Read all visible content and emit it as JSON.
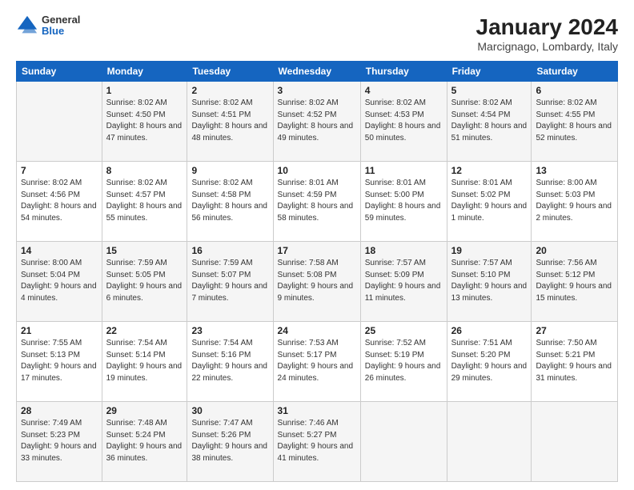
{
  "header": {
    "logo_general": "General",
    "logo_blue": "Blue",
    "main_title": "January 2024",
    "subtitle": "Marcignago, Lombardy, Italy"
  },
  "columns": [
    "Sunday",
    "Monday",
    "Tuesday",
    "Wednesday",
    "Thursday",
    "Friday",
    "Saturday"
  ],
  "weeks": [
    [
      {
        "day": "",
        "sunrise": "",
        "sunset": "",
        "daylight": ""
      },
      {
        "day": "1",
        "sunrise": "Sunrise: 8:02 AM",
        "sunset": "Sunset: 4:50 PM",
        "daylight": "Daylight: 8 hours and 47 minutes."
      },
      {
        "day": "2",
        "sunrise": "Sunrise: 8:02 AM",
        "sunset": "Sunset: 4:51 PM",
        "daylight": "Daylight: 8 hours and 48 minutes."
      },
      {
        "day": "3",
        "sunrise": "Sunrise: 8:02 AM",
        "sunset": "Sunset: 4:52 PM",
        "daylight": "Daylight: 8 hours and 49 minutes."
      },
      {
        "day": "4",
        "sunrise": "Sunrise: 8:02 AM",
        "sunset": "Sunset: 4:53 PM",
        "daylight": "Daylight: 8 hours and 50 minutes."
      },
      {
        "day": "5",
        "sunrise": "Sunrise: 8:02 AM",
        "sunset": "Sunset: 4:54 PM",
        "daylight": "Daylight: 8 hours and 51 minutes."
      },
      {
        "day": "6",
        "sunrise": "Sunrise: 8:02 AM",
        "sunset": "Sunset: 4:55 PM",
        "daylight": "Daylight: 8 hours and 52 minutes."
      }
    ],
    [
      {
        "day": "7",
        "sunrise": "Sunrise: 8:02 AM",
        "sunset": "Sunset: 4:56 PM",
        "daylight": "Daylight: 8 hours and 54 minutes."
      },
      {
        "day": "8",
        "sunrise": "Sunrise: 8:02 AM",
        "sunset": "Sunset: 4:57 PM",
        "daylight": "Daylight: 8 hours and 55 minutes."
      },
      {
        "day": "9",
        "sunrise": "Sunrise: 8:02 AM",
        "sunset": "Sunset: 4:58 PM",
        "daylight": "Daylight: 8 hours and 56 minutes."
      },
      {
        "day": "10",
        "sunrise": "Sunrise: 8:01 AM",
        "sunset": "Sunset: 4:59 PM",
        "daylight": "Daylight: 8 hours and 58 minutes."
      },
      {
        "day": "11",
        "sunrise": "Sunrise: 8:01 AM",
        "sunset": "Sunset: 5:00 PM",
        "daylight": "Daylight: 8 hours and 59 minutes."
      },
      {
        "day": "12",
        "sunrise": "Sunrise: 8:01 AM",
        "sunset": "Sunset: 5:02 PM",
        "daylight": "Daylight: 9 hours and 1 minute."
      },
      {
        "day": "13",
        "sunrise": "Sunrise: 8:00 AM",
        "sunset": "Sunset: 5:03 PM",
        "daylight": "Daylight: 9 hours and 2 minutes."
      }
    ],
    [
      {
        "day": "14",
        "sunrise": "Sunrise: 8:00 AM",
        "sunset": "Sunset: 5:04 PM",
        "daylight": "Daylight: 9 hours and 4 minutes."
      },
      {
        "day": "15",
        "sunrise": "Sunrise: 7:59 AM",
        "sunset": "Sunset: 5:05 PM",
        "daylight": "Daylight: 9 hours and 6 minutes."
      },
      {
        "day": "16",
        "sunrise": "Sunrise: 7:59 AM",
        "sunset": "Sunset: 5:07 PM",
        "daylight": "Daylight: 9 hours and 7 minutes."
      },
      {
        "day": "17",
        "sunrise": "Sunrise: 7:58 AM",
        "sunset": "Sunset: 5:08 PM",
        "daylight": "Daylight: 9 hours and 9 minutes."
      },
      {
        "day": "18",
        "sunrise": "Sunrise: 7:57 AM",
        "sunset": "Sunset: 5:09 PM",
        "daylight": "Daylight: 9 hours and 11 minutes."
      },
      {
        "day": "19",
        "sunrise": "Sunrise: 7:57 AM",
        "sunset": "Sunset: 5:10 PM",
        "daylight": "Daylight: 9 hours and 13 minutes."
      },
      {
        "day": "20",
        "sunrise": "Sunrise: 7:56 AM",
        "sunset": "Sunset: 5:12 PM",
        "daylight": "Daylight: 9 hours and 15 minutes."
      }
    ],
    [
      {
        "day": "21",
        "sunrise": "Sunrise: 7:55 AM",
        "sunset": "Sunset: 5:13 PM",
        "daylight": "Daylight: 9 hours and 17 minutes."
      },
      {
        "day": "22",
        "sunrise": "Sunrise: 7:54 AM",
        "sunset": "Sunset: 5:14 PM",
        "daylight": "Daylight: 9 hours and 19 minutes."
      },
      {
        "day": "23",
        "sunrise": "Sunrise: 7:54 AM",
        "sunset": "Sunset: 5:16 PM",
        "daylight": "Daylight: 9 hours and 22 minutes."
      },
      {
        "day": "24",
        "sunrise": "Sunrise: 7:53 AM",
        "sunset": "Sunset: 5:17 PM",
        "daylight": "Daylight: 9 hours and 24 minutes."
      },
      {
        "day": "25",
        "sunrise": "Sunrise: 7:52 AM",
        "sunset": "Sunset: 5:19 PM",
        "daylight": "Daylight: 9 hours and 26 minutes."
      },
      {
        "day": "26",
        "sunrise": "Sunrise: 7:51 AM",
        "sunset": "Sunset: 5:20 PM",
        "daylight": "Daylight: 9 hours and 29 minutes."
      },
      {
        "day": "27",
        "sunrise": "Sunrise: 7:50 AM",
        "sunset": "Sunset: 5:21 PM",
        "daylight": "Daylight: 9 hours and 31 minutes."
      }
    ],
    [
      {
        "day": "28",
        "sunrise": "Sunrise: 7:49 AM",
        "sunset": "Sunset: 5:23 PM",
        "daylight": "Daylight: 9 hours and 33 minutes."
      },
      {
        "day": "29",
        "sunrise": "Sunrise: 7:48 AM",
        "sunset": "Sunset: 5:24 PM",
        "daylight": "Daylight: 9 hours and 36 minutes."
      },
      {
        "day": "30",
        "sunrise": "Sunrise: 7:47 AM",
        "sunset": "Sunset: 5:26 PM",
        "daylight": "Daylight: 9 hours and 38 minutes."
      },
      {
        "day": "31",
        "sunrise": "Sunrise: 7:46 AM",
        "sunset": "Sunset: 5:27 PM",
        "daylight": "Daylight: 9 hours and 41 minutes."
      },
      {
        "day": "",
        "sunrise": "",
        "sunset": "",
        "daylight": ""
      },
      {
        "day": "",
        "sunrise": "",
        "sunset": "",
        "daylight": ""
      },
      {
        "day": "",
        "sunrise": "",
        "sunset": "",
        "daylight": ""
      }
    ]
  ]
}
